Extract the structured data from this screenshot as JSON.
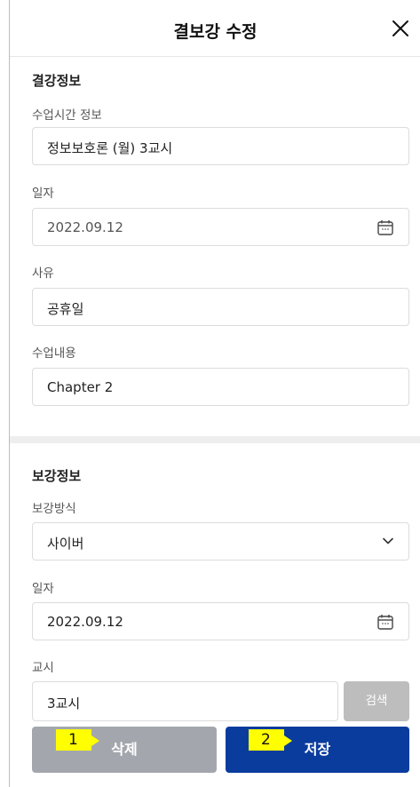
{
  "header": {
    "title": "결보강 수정",
    "close_icon": "close-icon"
  },
  "absence": {
    "section_title": "결강정보",
    "class_time": {
      "label": "수업시간 정보",
      "value": "정보보호론 (월) 3교시"
    },
    "date": {
      "label": "일자",
      "value": "2022.09.12",
      "icon": "calendar-icon"
    },
    "reason": {
      "label": "사유",
      "value": "공휴일"
    },
    "content": {
      "label": "수업내용",
      "value": "Chapter 2"
    }
  },
  "makeup": {
    "section_title": "보강정보",
    "method": {
      "label": "보강방식",
      "value": "사이버",
      "icon": "chevron-down-icon"
    },
    "date": {
      "label": "일자",
      "value": "2022.09.12",
      "icon": "calendar-icon"
    },
    "period": {
      "label": "교시",
      "value": "3교시",
      "search_label": "검색"
    }
  },
  "actions": {
    "delete_label": "삭제",
    "save_label": "저장",
    "delete_badge": "1",
    "save_badge": "2"
  },
  "colors": {
    "primary": "#0a3c9e",
    "disabled": "#a3a7ad",
    "search_disabled": "#bdbdbd",
    "badge": "#ffff00"
  }
}
